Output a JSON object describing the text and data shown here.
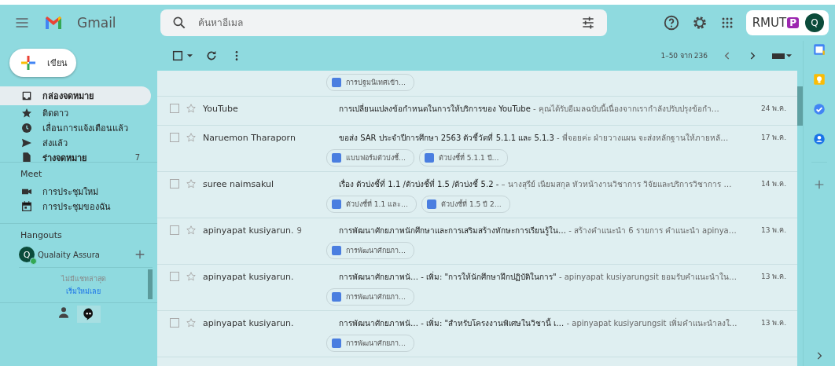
{
  "header": {
    "app_name": "Gmail",
    "search": {
      "placeholder": "ค้นหาอีเมล"
    },
    "org_badge": {
      "text": "RMUT",
      "mark": "P"
    },
    "avatar": {
      "initial": "Q"
    }
  },
  "compose": {
    "label": "เขียน"
  },
  "nav": [
    {
      "kind": "inbox",
      "label": "กล่องจดหมาย",
      "selected": true,
      "unread": true
    },
    {
      "kind": "starred",
      "label": "ติดดาว",
      "selected": false,
      "unread": false
    },
    {
      "kind": "snoozed",
      "label": "เลื่อนการแจ้งเตือนแล้ว",
      "selected": false,
      "unread": false
    },
    {
      "kind": "sent",
      "label": "ส่งแล้ว",
      "selected": false,
      "unread": false
    },
    {
      "kind": "drafts",
      "label": "ร่างจดหมาย",
      "selected": false,
      "unread": true,
      "count": "7"
    }
  ],
  "meet": {
    "title": "Meet",
    "items": [
      {
        "kind": "new",
        "label": "การประชุมใหม่"
      },
      {
        "kind": "mine",
        "label": "การประชุมของฉัน"
      }
    ]
  },
  "hangouts": {
    "title": "Hangouts",
    "user": {
      "initial": "Q",
      "name": "Qualaity Assura",
      "online": true
    },
    "empty_text": "ไม่มีแชทล่าสุด",
    "start_link": "เริ่มใหม่เลย"
  },
  "toolbar": {
    "select_all_checked": false,
    "range": "1–50 จาก 236"
  },
  "emails": [
    {
      "kind": "partial",
      "attachments": [
        "การปฐมนิเทศเข้า…"
      ]
    },
    {
      "kind": "full",
      "sender": "YouTube",
      "checked": false,
      "starred": false,
      "subject": "การเปลี่ยนแปลงข้อกำหนดในการให้บริการของ YouTube",
      "snippet": " - คุณได้รับอีเมลฉบับนี้เนื่องจากเรากำลังปรับปรุงข้อกำ…",
      "date": "24 พ.ค."
    },
    {
      "kind": "full",
      "sender": "Naruemon Tharaporn",
      "checked": false,
      "starred": false,
      "subject": "ขอส่ง SAR ประจำปีการศึกษา 2563 ตัวชี้วัดที่ 5.1.1 และ 5.1.3",
      "snippet": " - พี่จอยค่ะ ฝ่ายวางแผน จะส่งหลักฐานให้ภายหลั…",
      "date": "17 พ.ค.",
      "attachments": [
        "แบบฟอร์มตัวบ่งชี้…",
        "ตัวบ่งชี้ที่ 5.1.1 ปี…"
      ]
    },
    {
      "kind": "full",
      "sender": "suree naimsakul",
      "checked": false,
      "starred": false,
      "subject": "เรื่อง ตัวบ่งชี้ที่ 1.1 /ตัวบ่งชี้ที่ 1.5 /ตัวบ่งชี้ 5.2 -",
      "snippet": " – นางสุรีย์ เนียมสกุล หัวหน้างานวิชาการ วิจัยและบริการวิชาการ …",
      "date": "14 พ.ค.",
      "attachments": [
        "ตัวบ่งชี้ที่ 1.1 และ…",
        "ตัวบ่งชี้ที่ 1.5 ปี 2…"
      ]
    },
    {
      "kind": "full",
      "sender": "apinyapat kusiyarun.",
      "count": "9",
      "checked": false,
      "starred": false,
      "subject": "การพัฒนาศักยภาพนักศึกษาและการเสริมสร้างทักษะการเรียนรู้ใน…",
      "snippet": " - สร้างคำแนะนำ 6 รายการ คำแนะนำ apinya…",
      "date": "13 พ.ค.",
      "attachments": [
        "การพัฒนาศักยภา…"
      ]
    },
    {
      "kind": "full",
      "sender": "apinyapat kusiyarun.",
      "checked": false,
      "starred": false,
      "subject": "การพัฒนาศักยภาพนั… - เพิ่ม: \"การให้นักศึกษาฝึกปฏิบัติในการ\"",
      "snippet": " - apinyapat kusiyarungsit ยอมรับคำแนะนำใน…",
      "date": "13 พ.ค.",
      "attachments": [
        "การพัฒนาศักยภา…"
      ]
    },
    {
      "kind": "full",
      "sender": "apinyapat kusiyarun.",
      "checked": false,
      "starred": false,
      "subject": "การพัฒนาศักยภาพนั… - เพิ่ม: \"สำหรับโครงงานพิเศษในวิชานี้ เ…",
      "snippet": " - apinyapat kusiyarungsit เพิ่มคำแนะนำลงใ…",
      "date": "13 พ.ค.",
      "attachments": [
        "การพัฒนาศักยภา…"
      ]
    }
  ]
}
